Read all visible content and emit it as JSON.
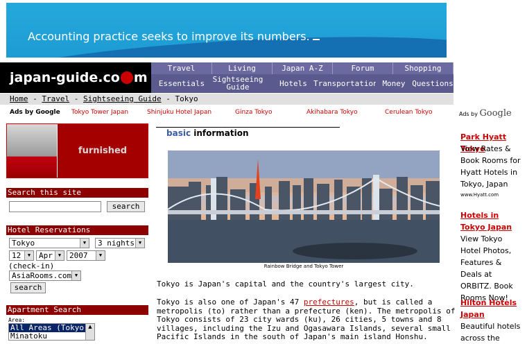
{
  "banner": {
    "text": "Accounting practice seeks to improve its numbers."
  },
  "logo": {
    "left": "japan-guide",
    "right": "m"
  },
  "nav_top": [
    "Travel",
    "Living",
    "Japan A-Z",
    "Forum",
    "Shopping"
  ],
  "nav_bottom": [
    "Essentials",
    "Sightseeing Guide",
    "Hotels",
    "Transportation",
    "Money",
    "Questions"
  ],
  "breadcrumb": {
    "home": "Home",
    "travel": "Travel",
    "sightseeing": "Sightseeing Guide",
    "current": "Tokyo",
    "sep": "-"
  },
  "ads_row": {
    "label": "Ads by Google",
    "links": [
      "Tokyo Tower Japan",
      "Shinjuku Hotel Japan",
      "Ginza Tokyo",
      "Akihabara Tokyo",
      "Cerulean Tokyo"
    ]
  },
  "furnished_ad": {
    "text": "furnished"
  },
  "search": {
    "heading": "Search this site",
    "value": "",
    "button": "search"
  },
  "hotel": {
    "heading": "Hotel Reservations",
    "city": "Tokyo",
    "nights": "3 nights",
    "day": "12",
    "month": "Apr",
    "year": "2007",
    "checkin": "(check-in)",
    "provider": "AsiaRooms.com",
    "button": "search"
  },
  "apartment": {
    "heading": "Apartment Search",
    "area_label": "Area:",
    "options": [
      "All Areas (Tokyo)",
      "Minatoku"
    ]
  },
  "article": {
    "section_prefix": "basic",
    "section_rest": " information",
    "caption": "Rainbow Bridge and Tokyo Tower",
    "p1": "Tokyo is Japan's capital and the country's largest city.",
    "p2_a": "Tokyo is also one of Japan's 47 ",
    "p2_link": "prefectures",
    "p2_b": ", but is called a",
    "p2_lines": [
      "metropolis (to) rather than a prefecture (ken). The metropolis of",
      "Tokyo consists of 23 city wards (ku), 26 cities, 5 towns and 8",
      "villages, including the Izu and Ogasawara Islands, several small",
      "Pacific Islands in the south of Japan's main island Honshu."
    ]
  },
  "right_ads": {
    "label": "Ads by",
    "google": "Google",
    "items": [
      {
        "title": "Park Hyatt Tokyo",
        "body": "View Rates & Book Rooms for Hyatt Hotels in Tokyo, Japan",
        "url": "www.Hyatt.com"
      },
      {
        "title": "Hotels in Tokyo Japan",
        "body": "View Tokyo Hotel Photos, Features & Deals at ORBITZ. Book Rooms Now!"
      },
      {
        "title": "Hilton Hotels Japan",
        "body": "Beautiful hotels across the"
      }
    ]
  },
  "colors": {
    "nav": "#5a5a8f",
    "section": "#8c0000",
    "banner": "#1d9bd3",
    "link": "#c00"
  }
}
